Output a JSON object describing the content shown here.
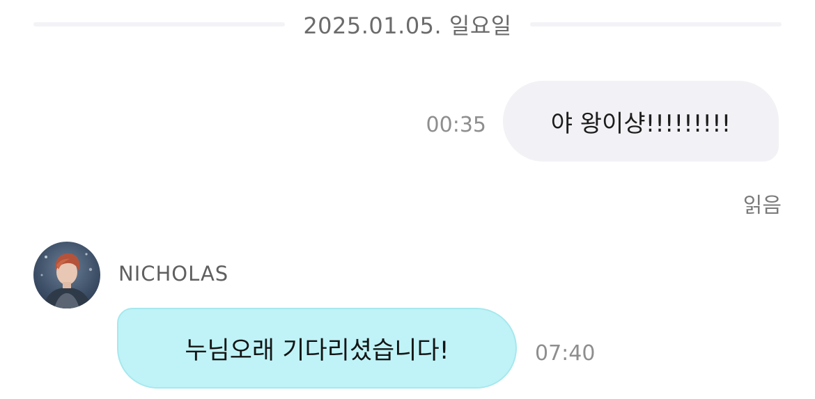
{
  "chat": {
    "date_divider": "2025.01.05. 일요일",
    "messages": [
      {
        "direction": "outgoing",
        "text": "야 왕이샹!!!!!!!!!",
        "time": "00:35",
        "status": "읽음"
      },
      {
        "direction": "incoming",
        "sender": "NICHOLAS",
        "avatar": "profile-photo",
        "text": "누님오래 기다리셨습니다!",
        "time": "07:40"
      }
    ]
  },
  "colors": {
    "outgoing_bubble": "#f2f2f6",
    "incoming_bubble": "#bff3f7",
    "timestamp": "#8e8e8e",
    "divider_line": "#f3f3f7"
  }
}
